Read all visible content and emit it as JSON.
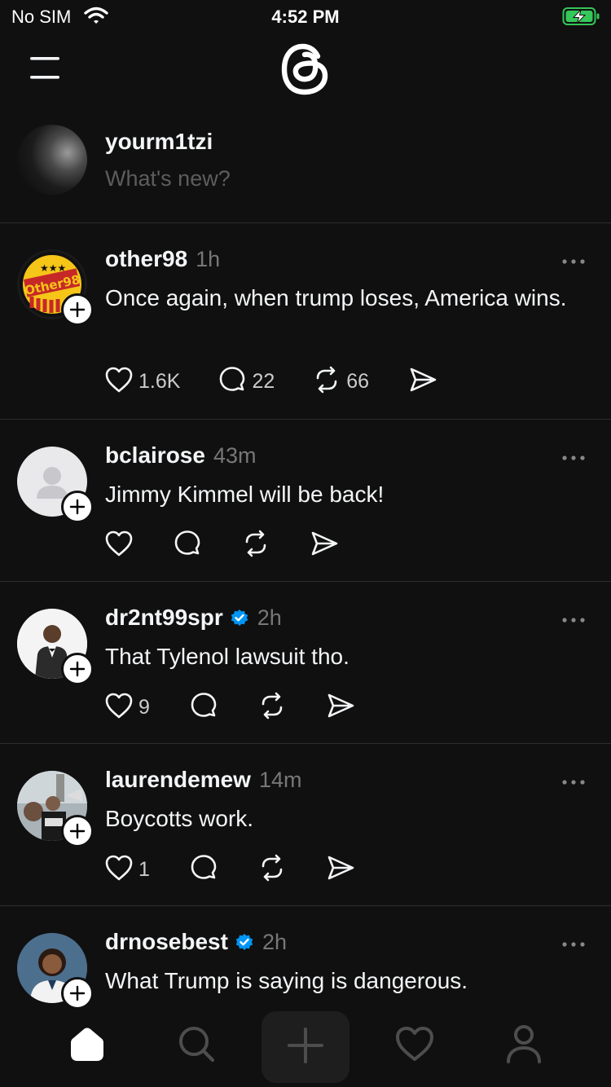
{
  "status_bar": {
    "carrier": "No SIM",
    "time": "4:52 PM",
    "icons": [
      "wifi-icon",
      "battery-charging-icon"
    ],
    "battery_color": "#34c759"
  },
  "header": {
    "menu_icon": "menu-icon",
    "logo": "threads-logo"
  },
  "composer": {
    "username": "yourm1tzi",
    "placeholder": "What's new?"
  },
  "feed": [
    {
      "username": "other98",
      "verified": false,
      "time": "1h",
      "text": "Once again, when trump loses, America wins.",
      "likes": "1.6K",
      "replies": "22",
      "reposts": "66",
      "avatar": "other98-logo"
    },
    {
      "username": "bclairose",
      "verified": false,
      "time": "43m",
      "text": "Jimmy Kimmel will be back!",
      "likes": "",
      "replies": "",
      "reposts": "",
      "avatar": "default-avatar"
    },
    {
      "username": "dr2nt99spr",
      "verified": true,
      "time": "2h",
      "text": "That Tylenol lawsuit tho.",
      "likes": "9",
      "replies": "",
      "reposts": "",
      "avatar": "photo"
    },
    {
      "username": "laurendemew",
      "verified": false,
      "time": "14m",
      "text": "Boycotts work.",
      "likes": "1",
      "replies": "",
      "reposts": "",
      "avatar": "photo"
    },
    {
      "username": "drnosebest",
      "verified": true,
      "time": "2h",
      "text": "What Trump is saying is dangerous.",
      "avatar": "photo"
    }
  ],
  "tabbar": {
    "items": [
      "home-icon",
      "search-icon",
      "create-icon",
      "activity-heart-icon",
      "profile-icon"
    ]
  },
  "colors": {
    "background": "#101010",
    "text": "#f3f5f7",
    "muted": "#777777",
    "verified": "#0095f6",
    "divider": "#2d2d2d"
  }
}
